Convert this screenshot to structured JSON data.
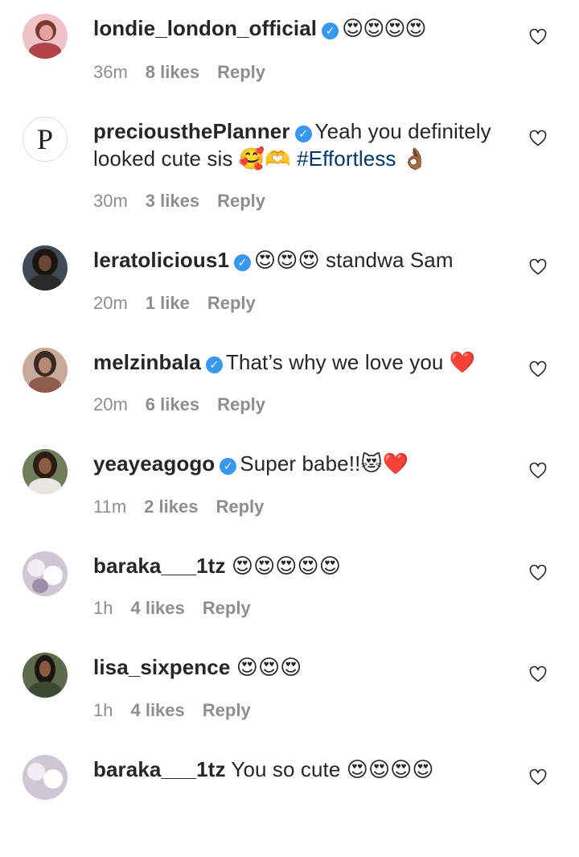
{
  "comments": [
    {
      "username": "londie_london_official",
      "verified": true,
      "text": "😍😍😍😍",
      "hashtag": "",
      "after": "",
      "time": "36m",
      "likes": "8 likes",
      "reply": "Reply",
      "avatar": {
        "kind": "photo",
        "colors": [
          "#f0c3c9",
          "#7a3a2e",
          "#e7a09c"
        ]
      }
    },
    {
      "username": "preciousthePlanner",
      "verified": true,
      "text": "Yeah you definitely looked cute sis 🥰🫶 ",
      "hashtag": "#Effortless",
      "after": " 👌🏾",
      "time": "30m",
      "likes": "3 likes",
      "reply": "Reply",
      "avatar": {
        "kind": "letter",
        "letter": "P"
      }
    },
    {
      "username": "leratolicious1",
      "verified": true,
      "text": "😍😍😍 standwa Sam",
      "hashtag": "",
      "after": "",
      "time": "20m",
      "likes": "1 like",
      "reply": "Reply",
      "avatar": {
        "kind": "photo",
        "colors": [
          "#3e4b57",
          "#1b1410",
          "#5a6c78"
        ]
      }
    },
    {
      "username": "melzinbala",
      "verified": true,
      "text": "That’s why we love you ❤️",
      "hashtag": "",
      "after": "",
      "time": "20m",
      "likes": "6 likes",
      "reply": "Reply",
      "avatar": {
        "kind": "photo",
        "colors": [
          "#c9a99a",
          "#3a2a22",
          "#b88a74"
        ]
      }
    },
    {
      "username": "yeayeagogo",
      "verified": true,
      "text": "Super babe!!😻❤️",
      "hashtag": "",
      "after": "",
      "time": "11m",
      "likes": "2 likes",
      "reply": "Reply",
      "avatar": {
        "kind": "photo",
        "colors": [
          "#6f7f5c",
          "#2a1c15",
          "#e8e6e0"
        ]
      }
    },
    {
      "username": "baraka___1tz",
      "verified": false,
      "text": "😍😍😍😍😍",
      "hashtag": "",
      "after": "",
      "time": "1h",
      "likes": "4 likes",
      "reply": "Reply",
      "avatar": {
        "kind": "photo",
        "colors": [
          "#cfc6d6",
          "#f2eef4",
          "#9c8fa8"
        ]
      }
    },
    {
      "username": "lisa_sixpence",
      "verified": false,
      "text": "😍😍😍",
      "hashtag": "",
      "after": "",
      "time": "1h",
      "likes": "4 likes",
      "reply": "Reply",
      "avatar": {
        "kind": "photo",
        "colors": [
          "#5d6b4d",
          "#1e1612",
          "#3a4a30"
        ]
      }
    },
    {
      "username": "baraka___1tz",
      "verified": false,
      "text": "You so cute 😍😍😍😍",
      "hashtag": "",
      "after": "",
      "time": "",
      "likes": "",
      "reply": "",
      "avatar": {
        "kind": "photo",
        "colors": [
          "#cfc6d6",
          "#f2eef4",
          "#9c8fa8"
        ]
      }
    }
  ],
  "colors": {
    "username": "#262626",
    "meta": "#8e8e8e",
    "hashtag": "#00376b",
    "verified": "#3897f0"
  },
  "icons": {
    "heart": "heart-outline-icon",
    "verified": "verified-badge-icon"
  }
}
